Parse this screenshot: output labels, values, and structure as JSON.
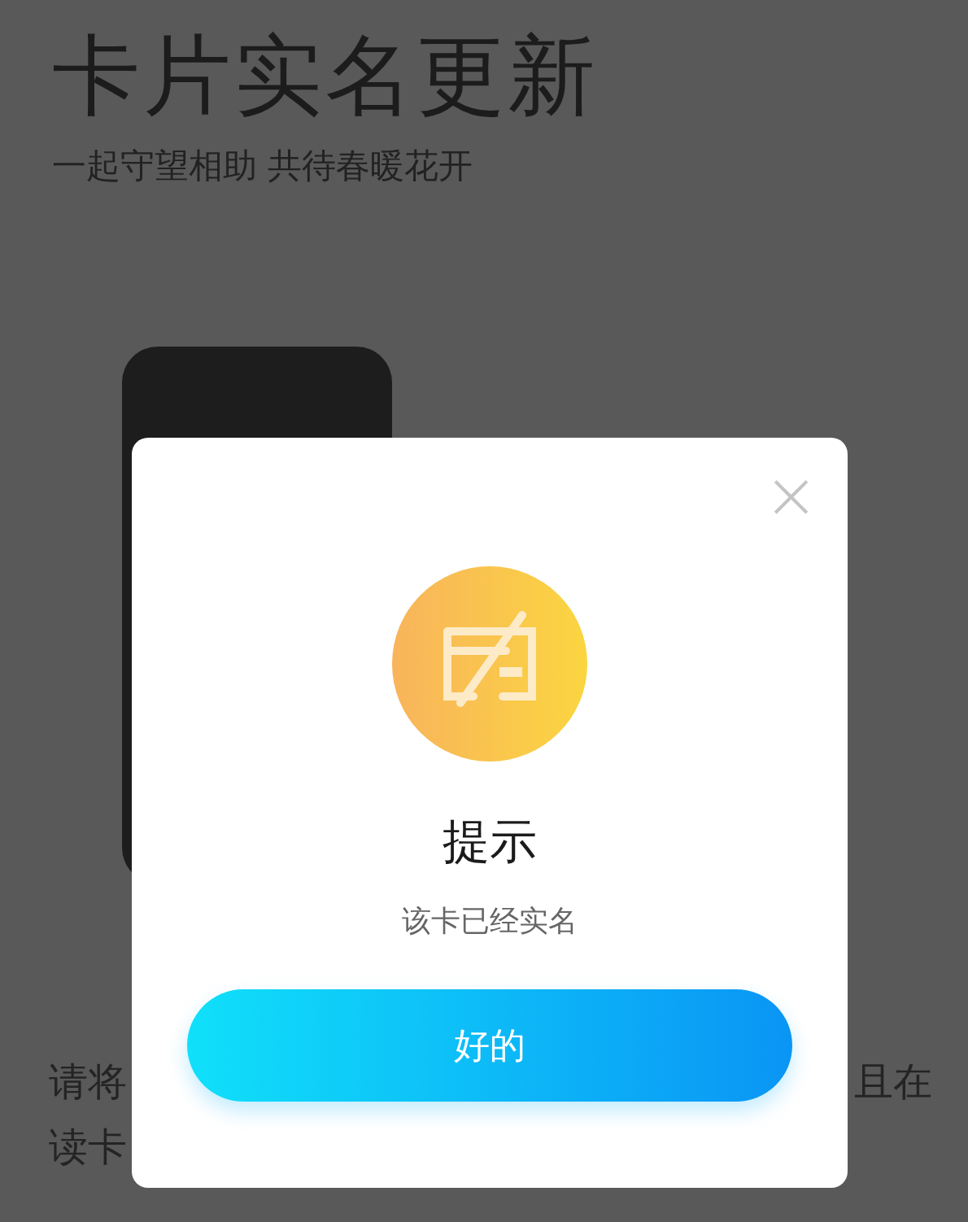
{
  "page": {
    "title": "卡片实名更新",
    "subtitle": "一起守望相助 共待春暖花开"
  },
  "instructions": {
    "line_1_left": "请将",
    "line_1_right": "且在",
    "line_2_left": "读卡"
  },
  "dialog": {
    "close": "×",
    "title": "提示",
    "message": "该卡已经实名",
    "button": "好的"
  }
}
